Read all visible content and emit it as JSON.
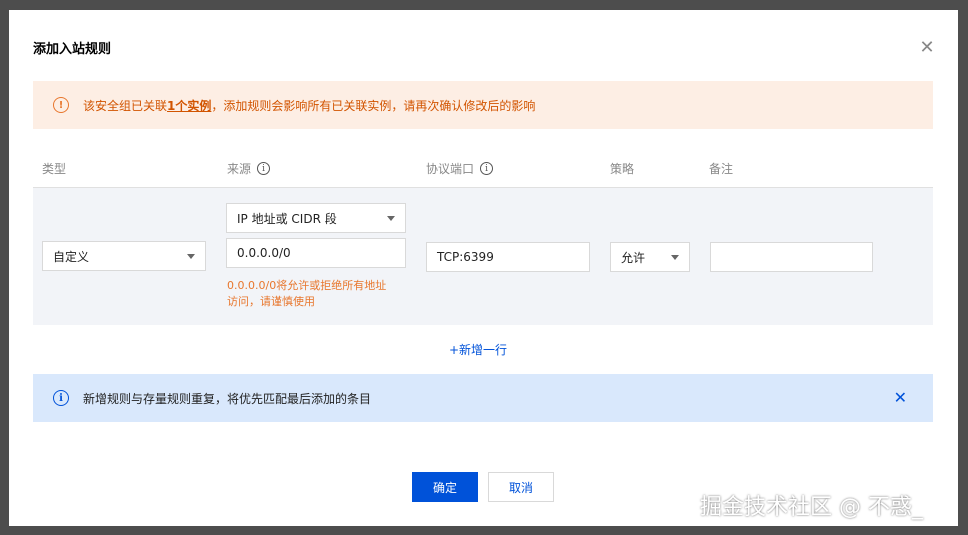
{
  "dialog": {
    "title": "添加入站规则",
    "close_glyph": "✕"
  },
  "warning": {
    "icon_glyph": "!",
    "text_before": "该安全组已关联",
    "link_text": "1个实例",
    "text_after": "，添加规则会影响所有已关联实例，请再次确认修改后的影响"
  },
  "columns": {
    "type": "类型",
    "source": "来源",
    "protocol_port": "协议端口",
    "policy": "策略",
    "remark": "备注",
    "info_glyph": "i"
  },
  "rule_row": {
    "type_value": "自定义",
    "source_type_value": "IP 地址或 CIDR 段",
    "source_value": "0.0.0.0/0",
    "source_hint": "0.0.0.0/0将允许或拒绝所有地址访问，请谨慎使用",
    "protocol_port_value": "TCP:6399",
    "policy_value": "允许",
    "remark_value": ""
  },
  "add_row_label": "+新增一行",
  "info_alert": {
    "icon_glyph": "i",
    "text": "新增规则与存量规则重复，将优先匹配最后添加的条目",
    "close_glyph": "✕"
  },
  "buttons": {
    "confirm": "确定",
    "cancel": "取消"
  },
  "watermark": "掘金技术社区 @ 不惑_",
  "colors": {
    "primary": "#0052d9",
    "warning_bg": "#fdeee4",
    "warning_text": "#d25400",
    "info_bg": "#d9e8fc",
    "row_bg": "#f2f4f8"
  }
}
